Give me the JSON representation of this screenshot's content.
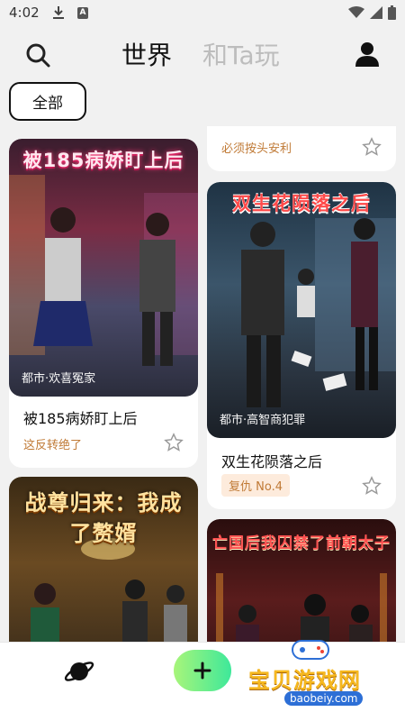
{
  "status": {
    "time": "4:02",
    "notif": "A"
  },
  "header": {
    "tabs": [
      "世界",
      "和Ta玩"
    ]
  },
  "filter": {
    "label": "全部"
  },
  "cards": [
    {
      "cover_title": "被185病娇盯上后",
      "tag": "都市·欢喜冤家",
      "title": "被185病娇盯上后",
      "subtitle": "这反转绝了"
    },
    {
      "subtitle": "必须按头安利"
    },
    {
      "cover_title": "双生花陨落之后",
      "tag": "都市·高智商犯罪",
      "title": "双生花陨落之后",
      "badge": "复仇 No.4"
    },
    {
      "cover_title": "战尊归来：我成了赘婿"
    },
    {
      "cover_title": "亡国后我囚禁了前朝太子"
    }
  ],
  "watermark": {
    "text": "宝贝游戏网",
    "url": "baobeiy.com"
  },
  "icons": [
    "search-icon",
    "user-icon",
    "star-icon",
    "planet-icon",
    "plus-icon"
  ],
  "colors": {
    "accent_green": "#3ee89a",
    "tag_orange": "#c07a36"
  }
}
